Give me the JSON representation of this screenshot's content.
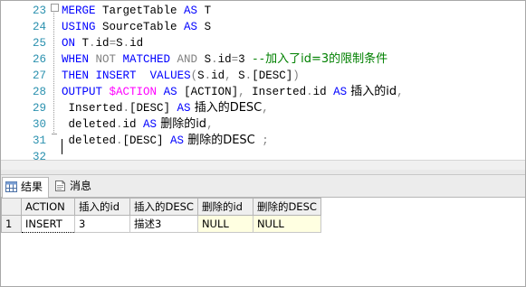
{
  "editor": {
    "lines": [
      {
        "num": "23",
        "tokens": [
          {
            "t": "MERGE",
            "c": "kw"
          },
          {
            "t": " TargetTable ",
            "c": "id"
          },
          {
            "t": "AS",
            "c": "kw"
          },
          {
            "t": " T",
            "c": "id"
          }
        ]
      },
      {
        "num": "24",
        "tokens": [
          {
            "t": "USING",
            "c": "kw"
          },
          {
            "t": " SourceTable ",
            "c": "id"
          },
          {
            "t": "AS",
            "c": "kw"
          },
          {
            "t": " S",
            "c": "id"
          }
        ]
      },
      {
        "num": "25",
        "tokens": [
          {
            "t": "ON",
            "c": "kw"
          },
          {
            "t": " T",
            "c": "id"
          },
          {
            "t": ".",
            "c": "gr"
          },
          {
            "t": "id",
            "c": "id"
          },
          {
            "t": "=",
            "c": "gr"
          },
          {
            "t": "S",
            "c": "id"
          },
          {
            "t": ".",
            "c": "gr"
          },
          {
            "t": "id",
            "c": "id"
          }
        ]
      },
      {
        "num": "26",
        "tokens": [
          {
            "t": "WHEN",
            "c": "kw"
          },
          {
            "t": " NOT ",
            "c": "gr"
          },
          {
            "t": "MATCHED",
            "c": "kw"
          },
          {
            "t": " AND ",
            "c": "gr"
          },
          {
            "t": "S",
            "c": "id"
          },
          {
            "t": ".",
            "c": "gr"
          },
          {
            "t": "id",
            "c": "id"
          },
          {
            "t": "=",
            "c": "gr"
          },
          {
            "t": "3 ",
            "c": "id"
          },
          {
            "t": "--",
            "c": "cm"
          },
          {
            "t": "加入了id=3的限制条件",
            "c": "cm zh"
          }
        ]
      },
      {
        "num": "27",
        "tokens": [
          {
            "t": "THEN",
            "c": "kw"
          },
          {
            "t": " ",
            "c": "id"
          },
          {
            "t": "INSERT",
            "c": "kw"
          },
          {
            "t": "  ",
            "c": "id"
          },
          {
            "t": "VALUES",
            "c": "kw"
          },
          {
            "t": "(",
            "c": "gr"
          },
          {
            "t": "S",
            "c": "id"
          },
          {
            "t": ".",
            "c": "gr"
          },
          {
            "t": "id",
            "c": "id"
          },
          {
            "t": ", ",
            "c": "gr"
          },
          {
            "t": "S",
            "c": "id"
          },
          {
            "t": ".",
            "c": "gr"
          },
          {
            "t": "[DESC]",
            "c": "id"
          },
          {
            "t": ")",
            "c": "gr"
          }
        ]
      },
      {
        "num": "28",
        "tokens": [
          {
            "t": "OUTPUT",
            "c": "kw"
          },
          {
            "t": " ",
            "c": "id"
          },
          {
            "t": "$ACTION",
            "c": "mg"
          },
          {
            "t": " ",
            "c": "id"
          },
          {
            "t": "AS",
            "c": "kw"
          },
          {
            "t": " [ACTION]",
            "c": "id"
          },
          {
            "t": ", ",
            "c": "gr"
          },
          {
            "t": "Inserted",
            "c": "id"
          },
          {
            "t": ".",
            "c": "gr"
          },
          {
            "t": "id ",
            "c": "id"
          },
          {
            "t": "AS",
            "c": "kw"
          },
          {
            "t": " 插入的id",
            "c": "id zh"
          },
          {
            "t": ",",
            "c": "gr"
          }
        ]
      },
      {
        "num": "29",
        "tokens": [
          {
            "t": " Inserted",
            "c": "id"
          },
          {
            "t": ".",
            "c": "gr"
          },
          {
            "t": "[DESC] ",
            "c": "id"
          },
          {
            "t": "AS",
            "c": "kw"
          },
          {
            "t": " 插入的DESC",
            "c": "id zh"
          },
          {
            "t": ",",
            "c": "gr"
          }
        ]
      },
      {
        "num": "30",
        "tokens": [
          {
            "t": " deleted",
            "c": "id"
          },
          {
            "t": ".",
            "c": "gr"
          },
          {
            "t": "id ",
            "c": "id"
          },
          {
            "t": "AS",
            "c": "kw"
          },
          {
            "t": " 删除的id",
            "c": "id zh"
          },
          {
            "t": ",",
            "c": "gr"
          }
        ]
      },
      {
        "num": "31",
        "tokens": [
          {
            "t": " deleted",
            "c": "id"
          },
          {
            "t": ".",
            "c": "gr"
          },
          {
            "t": "[DESC] ",
            "c": "id"
          },
          {
            "t": "AS",
            "c": "kw"
          },
          {
            "t": " 删除的DESC",
            "c": "id zh"
          },
          {
            "t": " ;",
            "c": "gr"
          }
        ]
      },
      {
        "num": "32",
        "tokens": []
      }
    ]
  },
  "results": {
    "tabs": [
      {
        "label": "结果",
        "icon": "grid-icon",
        "active": true
      },
      {
        "label": "消息",
        "icon": "message-icon",
        "active": false
      }
    ],
    "columns": [
      "ACTION",
      "插入的id",
      "插入的DESC",
      "删除的id",
      "删除的DESC"
    ],
    "rows": [
      {
        "num": "1",
        "cells": [
          "INSERT",
          "3",
          "描述3",
          "NULL",
          "NULL"
        ]
      }
    ]
  }
}
